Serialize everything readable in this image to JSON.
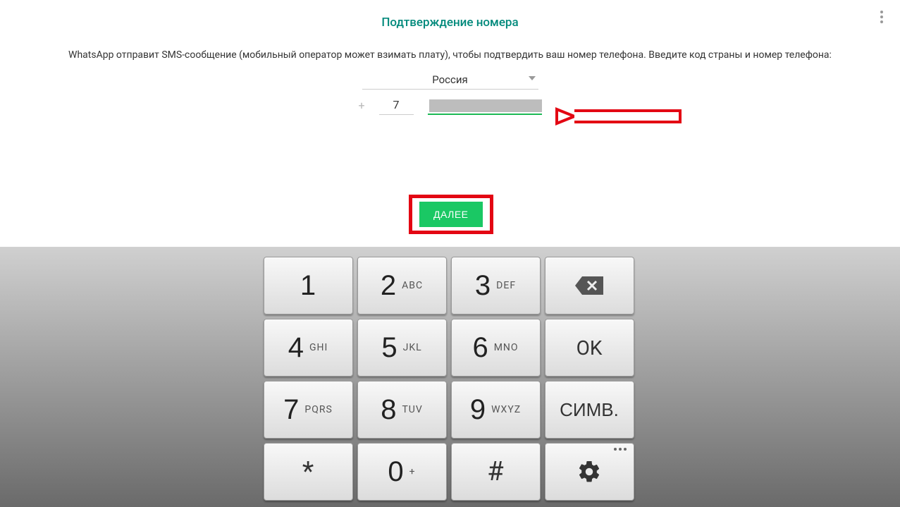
{
  "header": {
    "title": "Подтверждение номера"
  },
  "instruction": "WhatsApp отправит SMS-сообщение (мобильный оператор может взимать плату), чтобы подтвердить ваш номер телефона. Введите код страны и номер телефона:",
  "country": {
    "selected": "Россия"
  },
  "phone": {
    "plus": "+",
    "country_code": "7"
  },
  "actions": {
    "next": "ДАЛЕЕ"
  },
  "keypad": {
    "keys": [
      {
        "digit": "1",
        "letters": ""
      },
      {
        "digit": "2",
        "letters": "ABC"
      },
      {
        "digit": "3",
        "letters": "DEF"
      },
      {
        "digit": "4",
        "letters": "GHI"
      },
      {
        "digit": "5",
        "letters": "JKL"
      },
      {
        "digit": "6",
        "letters": "MNO"
      },
      {
        "digit": "7",
        "letters": "PQRS"
      },
      {
        "digit": "8",
        "letters": "TUV"
      },
      {
        "digit": "9",
        "letters": "WXYZ"
      },
      {
        "digit": "0",
        "letters": "+"
      }
    ],
    "ok": "OK",
    "sym": "СИМВ.",
    "star": "*",
    "pound": "#"
  }
}
